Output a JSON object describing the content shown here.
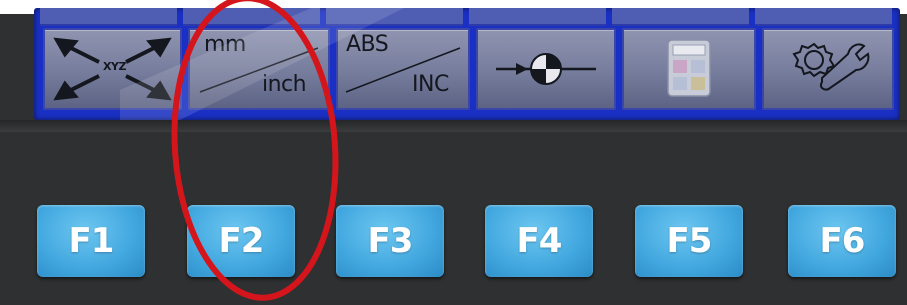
{
  "softkeys": [
    {
      "name": "xyz",
      "label": "XYZ",
      "icon": "four-arrows-icon"
    },
    {
      "name": "units",
      "top": "mm",
      "bottom": "inch"
    },
    {
      "name": "mode",
      "top": "ABS",
      "bottom": "INC"
    },
    {
      "name": "datum",
      "icon": "crosshair-target-icon"
    },
    {
      "name": "calculator",
      "icon": "calculator-icon"
    },
    {
      "name": "settings",
      "icon": "gear-wrench-icon"
    }
  ],
  "function_keys": [
    "F1",
    "F2",
    "F3",
    "F4",
    "F5",
    "F6"
  ],
  "colors": {
    "screen_blue": "#1a30c4",
    "key_blue": "#44a9e0",
    "annotation_red": "#d4161c",
    "body": "#2e3031"
  }
}
